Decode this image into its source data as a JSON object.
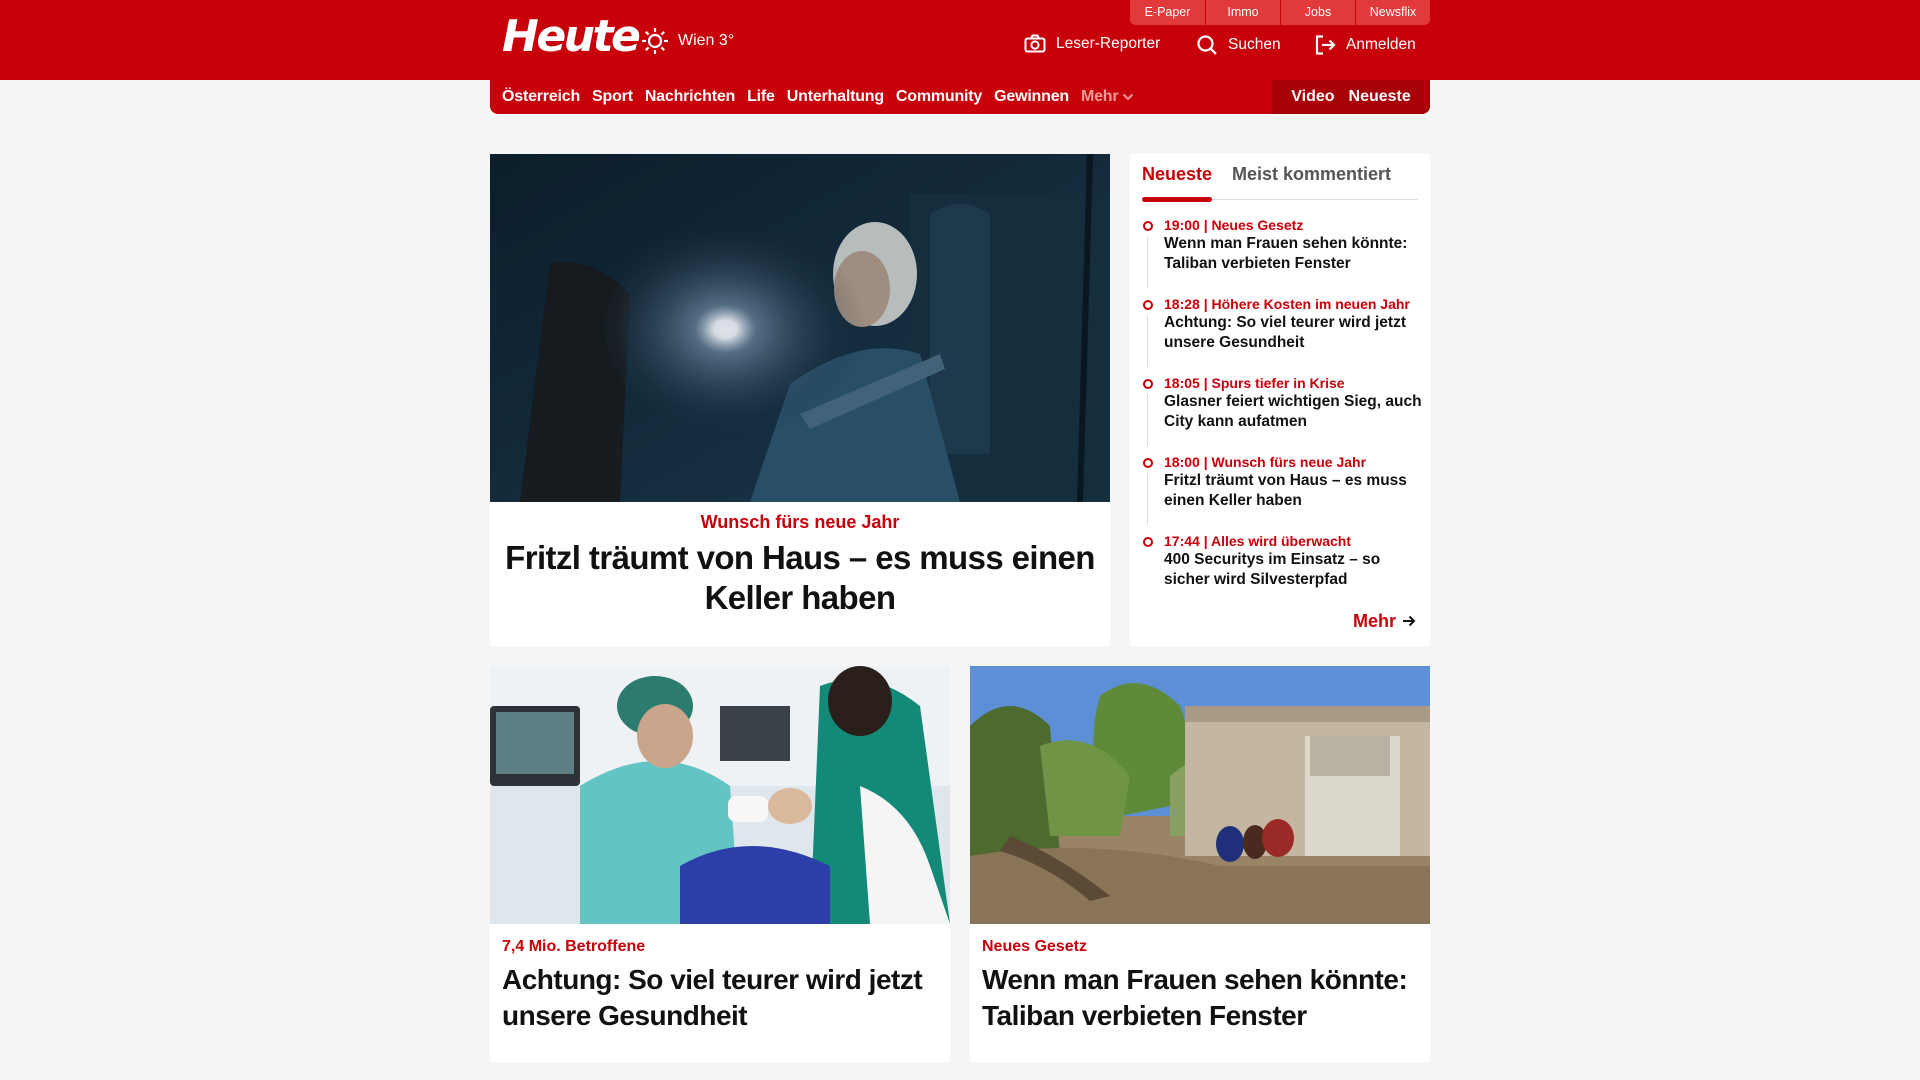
{
  "header": {
    "logo": "Heute",
    "weather": "Wien 3°",
    "top_links": [
      "E-Paper",
      "Immo",
      "Jobs",
      "Newsflix"
    ],
    "leser_reporter": "Leser-Reporter",
    "search": "Suchen",
    "login": "Anmelden"
  },
  "nav": {
    "items": [
      "Österreich",
      "Sport",
      "Nachrichten",
      "Life",
      "Unterhaltung",
      "Community",
      "Gewinnen"
    ],
    "more": "Mehr",
    "video": "Video",
    "latest": "Neueste"
  },
  "hero": {
    "kicker": "Wunsch fürs neue Jahr",
    "title": "Fritzl träumt von Haus – es muss einen Keller haben"
  },
  "sidebar": {
    "tab_latest": "Neueste",
    "tab_comments": "Meist kommentiert",
    "items": [
      {
        "meta": "19:00 | Neues Gesetz",
        "title": "Wenn man Frauen sehen könnte: Taliban verbieten Fenster"
      },
      {
        "meta": "18:28 | Höhere Kosten im neuen Jahr",
        "title": "Achtung: So viel teurer wird jetzt unsere Gesundheit"
      },
      {
        "meta": "18:05 | Spurs tiefer in Krise",
        "title": "Glasner feiert wichtigen Sieg, auch City kann aufatmen"
      },
      {
        "meta": "18:00 | Wunsch fürs neue Jahr",
        "title": "Fritzl träumt von Haus – es muss einen Keller haben"
      },
      {
        "meta": "17:44 | Alles wird überwacht",
        "title": "400 Securitys im Einsatz – so sicher wird Silvesterpfad"
      }
    ],
    "more": "Mehr"
  },
  "cards": [
    {
      "kicker": "7,4 Mio. Betroffene",
      "title": "Achtung: So viel teurer wird jetzt unsere Gesundheit"
    },
    {
      "kicker": "Neues Gesetz",
      "title": "Wenn man Frauen sehen könnte: Taliban verbieten Fenster"
    }
  ],
  "colors": {
    "brand_red": "#c8000a"
  }
}
